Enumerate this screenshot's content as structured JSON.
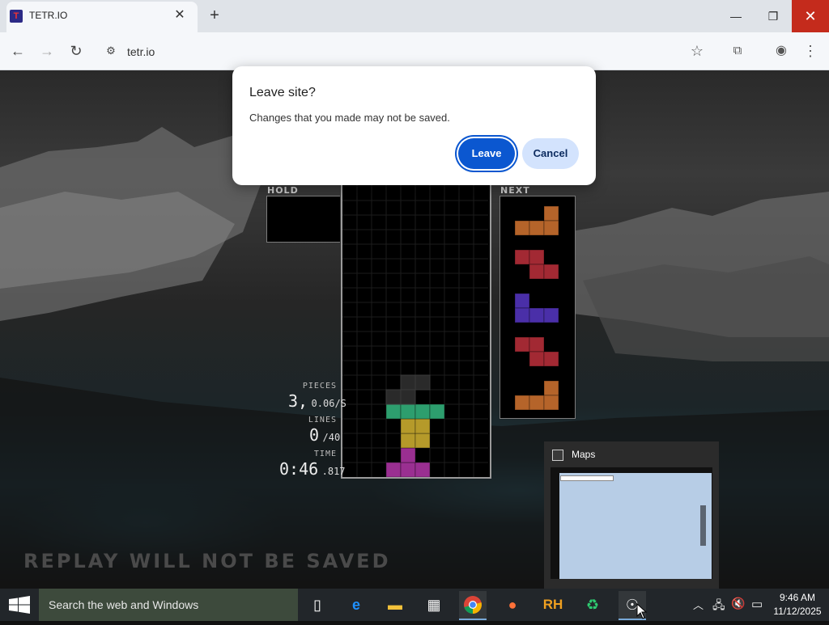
{
  "browser": {
    "tab": {
      "title": "TETR.IO",
      "favicon": "tetrio-logo-icon"
    },
    "new_tab": "+",
    "address": "tetr.io",
    "window_controls": {
      "minimize": "—",
      "maximize": "❐",
      "close": "✕"
    }
  },
  "dialog": {
    "title": "Leave site?",
    "message": "Changes that you made may not be saved.",
    "leave_label": "Leave",
    "cancel_label": "Cancel"
  },
  "game": {
    "hold_label": "HOLD",
    "next_label": "NEXT",
    "stats": {
      "pieces_label": "PIECES",
      "pieces_value": "3,",
      "pieces_rate": "0.06/S",
      "lines_label": "LINES",
      "lines_value": "0",
      "lines_goal": "/40",
      "time_label": "TIME",
      "time_value": "0:46",
      "time_ms": ".817"
    },
    "footer_note": "REPLAY WILL NOT BE SAVED",
    "next_queue": [
      "L",
      "Z",
      "J",
      "Z",
      "L"
    ],
    "colors": {
      "L": "#b5642a",
      "Z": "#a22933",
      "J": "#4a2fa8",
      "T": "#9a2f91",
      "S": "#2d9e6e",
      "O": "#b59a2a"
    }
  },
  "taskbar": {
    "search_placeholder": "Search the web and Windows",
    "apps": [
      "task-view-icon",
      "edge-icon",
      "file-explorer-icon",
      "store-icon",
      "chrome-icon",
      "firefox-icon",
      "rh-icon",
      "recycle-icon",
      "maps-icon"
    ],
    "rh_label": "RH",
    "time": "9:46 AM",
    "date": "11/12/2025"
  },
  "maps_preview": {
    "title": "Maps"
  }
}
